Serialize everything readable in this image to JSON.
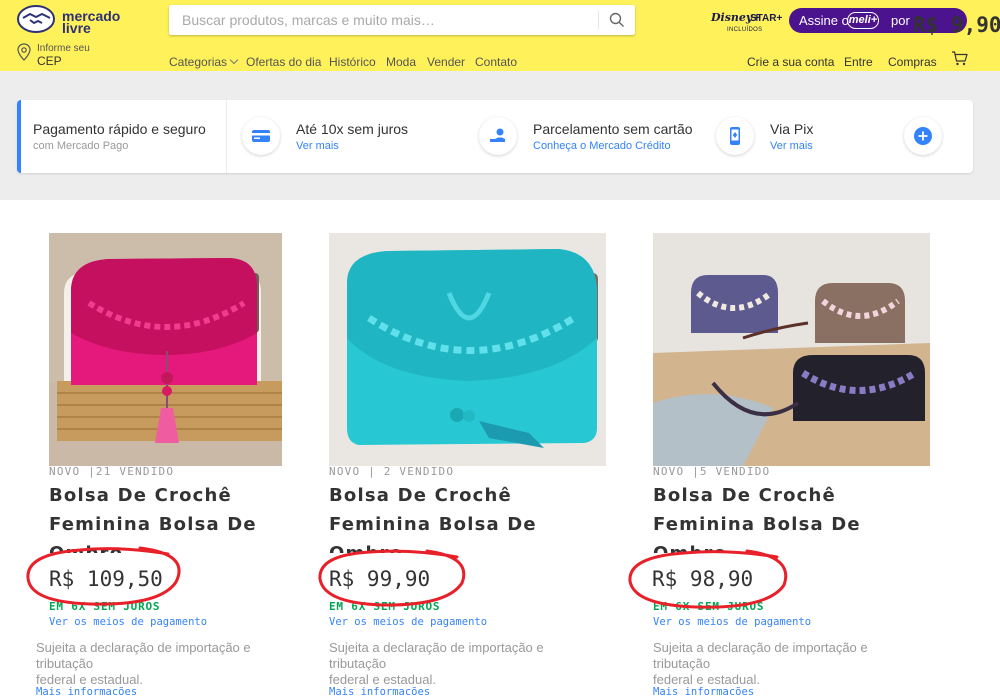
{
  "header": {
    "logo_line1": "mercado",
    "logo_line2": "livre",
    "search_placeholder": "Buscar produtos, marcas e muito mais…",
    "disney_line1": "Disney+",
    "disney_line2": "STAR+",
    "disney_line3": "INCLUÍDOS",
    "meli_prefix": "Assine o",
    "meli_badge": "meli+",
    "meli_por": "por",
    "meli_price": "R$ 9,90",
    "cep_line1": "Informe seu",
    "cep_line2": "CEP",
    "nav": [
      "Categorias",
      "Ofertas do dia",
      "Histórico",
      "Moda",
      "Vender",
      "Contato"
    ],
    "account": [
      "Crie a sua conta",
      "Entre",
      "Compras"
    ]
  },
  "payment": {
    "title": "Pagamento rápido e seguro",
    "subtitle": "com Mercado Pago",
    "options": [
      {
        "title": "Até 10x sem juros",
        "link": "Ver mais",
        "icon": "credit-card-icon"
      },
      {
        "title": "Parcelamento sem cartão",
        "link": "Conheça o Mercado Crédito",
        "icon": "hand-coin-icon"
      },
      {
        "title": "Via Pix",
        "link": "Ver mais",
        "icon": "phone-pix-icon"
      }
    ]
  },
  "products": [
    {
      "meta": "NOVO |21 VENDIDO",
      "title": "Bolsa De Crochê Feminina Bolsa De Ombro",
      "price": "R$ 109,50",
      "installments": "EM 6X SEM JUROS",
      "payment_link": "Ver os meios de pagamento",
      "tax_line1": "Sujeita a declaração de importação e",
      "tax_line2": "tributação",
      "tax_line3": "federal e estadual.",
      "more": "Mais informações",
      "bag_color": "#e4197b",
      "bg_color": "#c9b9a6"
    },
    {
      "meta": "NOVO | 2 VENDIDO",
      "title": "Bolsa De Crochê Feminina Bolsa De Ombro",
      "price": "R$ 99,90",
      "installments": "EM 6X SEM JUROS",
      "payment_link": "Ver os meios de pagamento",
      "tax_line1": "Sujeita a declaração de importação e",
      "tax_line2": "tributação",
      "tax_line3": "federal e estadual.",
      "more": "Mais informações",
      "bag_color": "#27c7d3",
      "bg_color": "#eae7e3"
    },
    {
      "meta": "NOVO |5 VENDIDO",
      "title": "Bolsa De Crochê Feminina Bolsa De Ombro",
      "price": "R$ 98,90",
      "installments": "EM 6X SEM JUROS",
      "payment_link": "Ver os meios de pagamento",
      "tax_line1": "Sujeita a declaração de importação e",
      "tax_line2": "tributação",
      "tax_line3": "federal e estadual.",
      "more": "Mais informações",
      "bag_color": "#6a5aa8",
      "bg_color": "#d8c8b6"
    }
  ],
  "colors": {
    "header_bg": "#fff159",
    "link_blue": "#3483fa",
    "green": "#00a650",
    "meli_purple": "#4b138d",
    "annotation_red": "#e8202a"
  }
}
